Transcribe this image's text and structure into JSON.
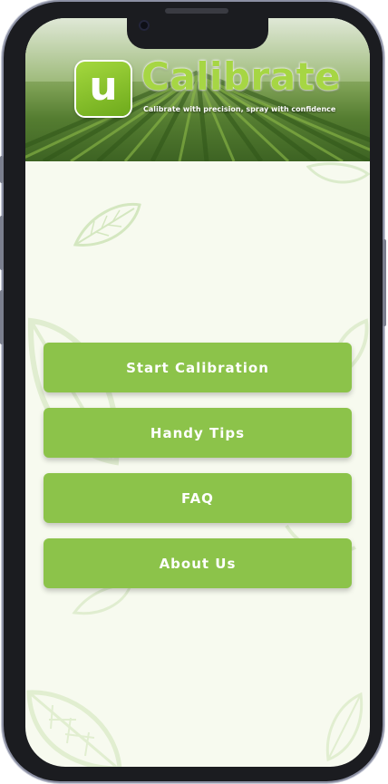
{
  "app": {
    "logo_letter": "u",
    "name": "Calibrate",
    "tagline": "Calibrate with precision, spray with confidence",
    "accent_color": "#8cc34a"
  },
  "menu": {
    "items": [
      {
        "label": "Start Calibration"
      },
      {
        "label": "Handy Tips"
      },
      {
        "label": "FAQ"
      },
      {
        "label": "About Us"
      }
    ]
  },
  "icons": {
    "decoration": "leaf-icon"
  }
}
